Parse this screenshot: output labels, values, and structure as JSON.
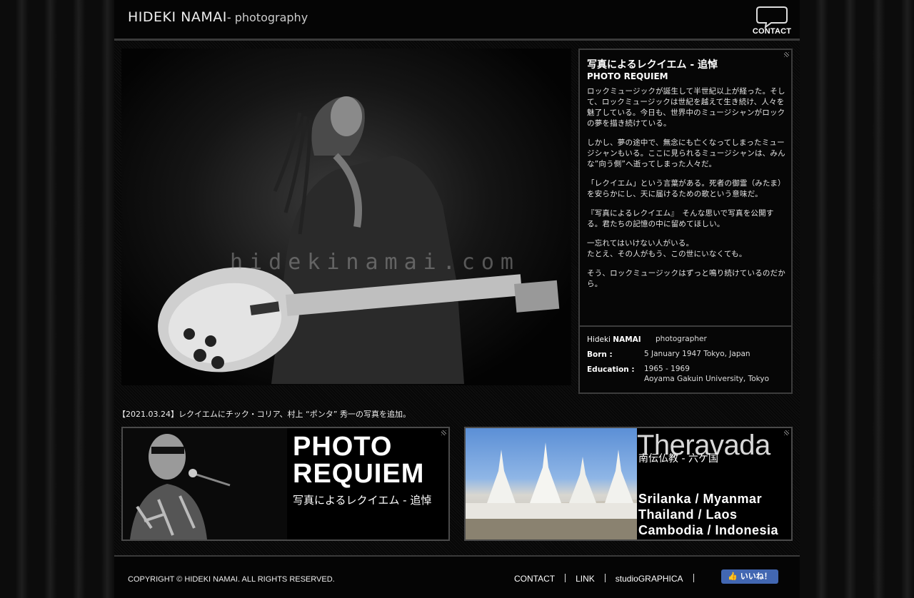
{
  "header": {
    "logo_name": "HIDEKI NAMAI",
    "logo_sub": "- photography",
    "contact_label": "CONTACT"
  },
  "hero": {
    "watermark": "hidekinamai.com"
  },
  "info": {
    "title": "写真によるレクイエム - 追悼",
    "subtitle": "PHOTO REQUIEM",
    "paragraphs": [
      "ロックミュージックが誕生して半世紀以上が経った。そして、ロックミュージックは世紀を越えて生き続け、人々を魅了している。今日も、世界中のミュージシャンがロックの夢を描き続けている。",
      "しかし、夢の途中で、無念にも亡くなってしまったミュージシャンもいる。ここに見られるミュージシャンは、みんな”向う側”へ逝ってしまった人々だ。",
      "「レクイエム」という言葉がある。死者の御霊（みたま）を安らかにし、天に届けるための歌という意味だ。",
      "『写真によるレクイエム』　そんな思いで写真を公開する。君たちの記憶の中に留めてほしい。",
      "一忘れてはいけない人がいる。\nたとえ、その人がもう、この世にいなくても。",
      "そう、ロックミュージックはずっと鳴り続けているのだから。"
    ],
    "profile": {
      "name_first": "Hideki ",
      "name_last": "NAMAI",
      "role": "photographer",
      "born_label": "Born :",
      "born_value": "5 January 1947 Tokyo, Japan",
      "education_label": "Education :",
      "education_years": "1965 - 1969",
      "education_school": "Aoyama Gakuin University, Tokyo"
    }
  },
  "news": "【2021.03.24】レクイエムにチック・コリア、村上 “ポンタ” 秀一の写真を追加。",
  "banners": {
    "requiem": {
      "line1": "PHOTO",
      "line2": "REQUIEM",
      "sub": "写真によるレクイエム - 追悼"
    },
    "theravada": {
      "title": "Theravada",
      "jp": "南伝仏教 - 六ケ国",
      "line1": "Srilanka / Myanmar",
      "line2": "Thailand / Laos",
      "line3": "Cambodia / Indonesia"
    }
  },
  "footer": {
    "copyright": "COPYRIGHT © HIDEKI NAMAI. ALL RIGHTS RESERVED.",
    "links": [
      "CONTACT",
      "LINK",
      "studioGRAPHICA"
    ],
    "like_label": "いいね！",
    "like_color": "#4267b2"
  }
}
